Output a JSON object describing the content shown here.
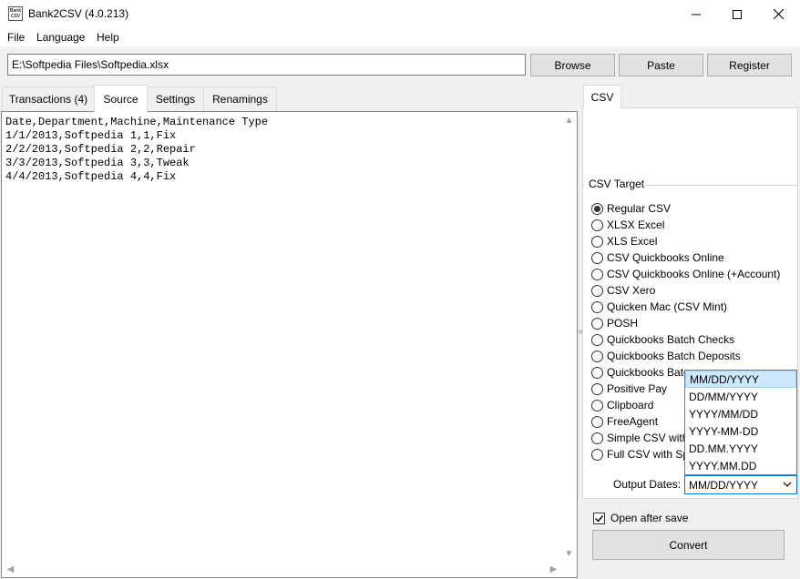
{
  "window": {
    "title": "Bank2CSV (4.0.213)",
    "icon_text": "Bank2 CSV",
    "controls": {
      "minimize": "minimize-icon",
      "maximize": "maximize-icon",
      "close": "close-icon"
    }
  },
  "menu": [
    "File",
    "Language",
    "Help"
  ],
  "path": {
    "value": "E:\\Softpedia Files\\Softpedia.xlsx"
  },
  "buttons": {
    "browse": "Browse",
    "paste": "Paste",
    "register": "Register",
    "convert": "Convert"
  },
  "tabs": [
    {
      "label": "Transactions (4)",
      "active": false
    },
    {
      "label": "Source",
      "active": true
    },
    {
      "label": "Settings",
      "active": false
    },
    {
      "label": "Renamings",
      "active": false
    }
  ],
  "source_lines": [
    "Date,Department,Machine,Maintenance Type",
    "1/1/2013,Softpedia 1,1,Fix",
    "2/2/2013,Softpedia 2,2,Repair",
    "3/3/2013,Softpedia 3,3,Tweak",
    "4/4/2013,Softpedia 4,4,Fix"
  ],
  "right_tab": "CSV",
  "csv_target": {
    "label": "CSV Target",
    "options": [
      {
        "label": "Regular CSV",
        "checked": true
      },
      {
        "label": "XLSX Excel",
        "checked": false
      },
      {
        "label": "XLS Excel",
        "checked": false
      },
      {
        "label": "CSV Quickbooks Online",
        "checked": false
      },
      {
        "label": "CSV Quickbooks Online (+Account)",
        "checked": false
      },
      {
        "label": "CSV Xero",
        "checked": false
      },
      {
        "label": "Quicken Mac (CSV Mint)",
        "checked": false
      },
      {
        "label": "POSH",
        "checked": false
      },
      {
        "label": "Quickbooks Batch Checks",
        "checked": false
      },
      {
        "label": "Quickbooks Batch Deposits",
        "checked": false
      },
      {
        "label": "Quickbooks Batc",
        "checked": false
      },
      {
        "label": "Positive Pay",
        "checked": false
      },
      {
        "label": "Clipboard",
        "checked": false
      },
      {
        "label": "FreeAgent",
        "checked": false
      },
      {
        "label": "Simple CSV with",
        "checked": false
      },
      {
        "label": "Full CSV with Sp",
        "checked": false
      }
    ]
  },
  "output_dates": {
    "label": "Output Dates:",
    "selected": "MM/DD/YYYY",
    "options": [
      "MM/DD/YYYY",
      "DD/MM/YYYY",
      "YYYY/MM/DD",
      "YYYY-MM-DD",
      "DD.MM.YYYY",
      "YYYY.MM.DD"
    ]
  },
  "open_after_save": {
    "label": "Open after save",
    "checked": true
  }
}
